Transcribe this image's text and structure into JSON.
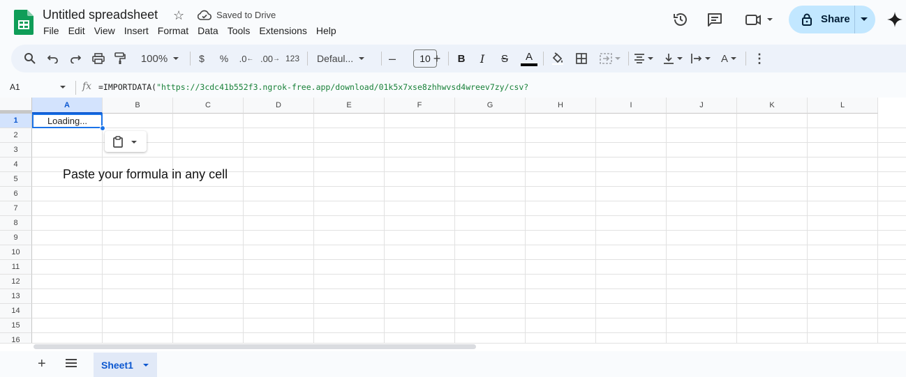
{
  "app": {
    "doc_title": "Untitled spreadsheet",
    "save_status": "Saved to Drive",
    "share_label": "Share"
  },
  "menu": [
    "File",
    "Edit",
    "View",
    "Insert",
    "Format",
    "Data",
    "Tools",
    "Extensions",
    "Help"
  ],
  "toolbar": {
    "zoom": "100%",
    "currency": "$",
    "percent": "%",
    "decrease_decimal": ".0",
    "increase_decimal": ".00",
    "number_format": "123",
    "font": "Defaul...",
    "font_size": "10",
    "bold": "B",
    "italic": "I",
    "strike": "S",
    "text_color": "A"
  },
  "formula_bar": {
    "cell_ref": "A1",
    "fx": "fx",
    "formula_prefix": "=IMPORTDATA(",
    "formula_string": "\"https://3cdc41b552f3.ngrok-free.app/download/01k5x7xse8zhhwvsd4wreev7zy/csv?"
  },
  "grid": {
    "columns": [
      "A",
      "B",
      "C",
      "D",
      "E",
      "F",
      "G",
      "H",
      "I",
      "J",
      "K",
      "L"
    ],
    "rows": [
      "1",
      "2",
      "3",
      "4",
      "5",
      "6",
      "7",
      "8",
      "9",
      "10",
      "11",
      "12",
      "13",
      "14",
      "15",
      "16"
    ],
    "selected_cell_value": "Loading..."
  },
  "overlay_text": "Paste your formula in any cell",
  "sheets": {
    "active_tab": "Sheet1"
  },
  "colors": {
    "accent": "#0b57d0",
    "share_bg": "#c2e7ff",
    "toolbar_bg": "#edf2fa",
    "formula_string": "#188038",
    "logo_green": "#0f9d58"
  }
}
